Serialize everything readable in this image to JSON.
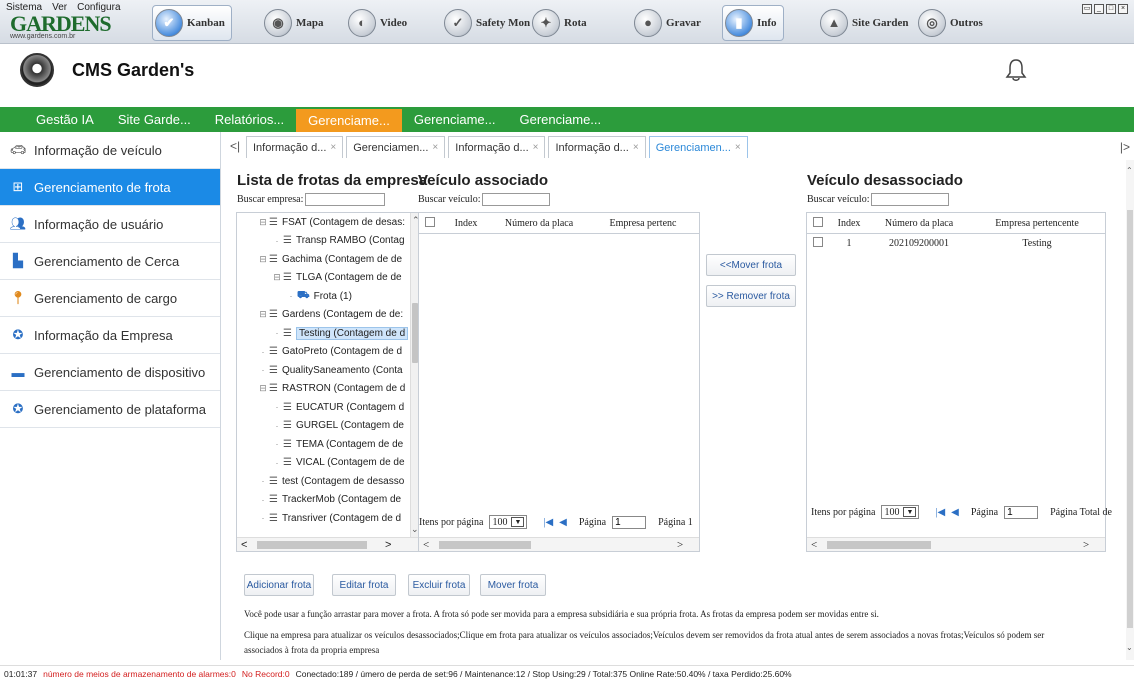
{
  "top_menu": [
    "Sistema",
    "Ver",
    "Configura"
  ],
  "logo": {
    "text": "GARDENS",
    "url": "www.gardens.com.br"
  },
  "toolbar": [
    {
      "label": "Kanban",
      "icon": "check-circle-icon",
      "active": true
    },
    {
      "label": "Mapa",
      "icon": "map-icon",
      "active": false
    },
    {
      "label": "Video",
      "icon": "video-icon",
      "active": false
    },
    {
      "label": "Safety Mon",
      "icon": "shield-icon",
      "active": false
    },
    {
      "label": "Rota",
      "icon": "route-icon",
      "active": false
    },
    {
      "label": "Gravar",
      "icon": "record-icon",
      "active": false
    },
    {
      "label": "Info",
      "icon": "info-chart-icon",
      "active": true
    },
    {
      "label": "Site Garden",
      "icon": "site-icon",
      "active": false
    },
    {
      "label": "Outros",
      "icon": "others-icon",
      "active": false
    }
  ],
  "header": {
    "title": "CMS Garden's"
  },
  "green_nav": [
    "Gestão IA",
    "Site Garde...",
    "Relatórios...",
    "Gerenciame...",
    "Gerenciame...",
    "Gerenciame..."
  ],
  "green_nav_active": 3,
  "sidebar": [
    {
      "label": "Informação de veículo",
      "icon": "car-icon"
    },
    {
      "label": "Gerenciamento de frota",
      "icon": "fleet-icon"
    },
    {
      "label": "Informação de usuário",
      "icon": "users-icon"
    },
    {
      "label": "Gerenciamento de Cerca",
      "icon": "fence-icon"
    },
    {
      "label": "Gerenciamento de cargo",
      "icon": "pin-icon"
    },
    {
      "label": "Informação da Empresa",
      "icon": "company-icon"
    },
    {
      "label": "Gerenciamento de dispositivo",
      "icon": "device-icon"
    },
    {
      "label": "Gerenciamento de plataforma",
      "icon": "platform-icon"
    }
  ],
  "sidebar_active": 1,
  "tabs": [
    "Informação d...",
    "Gerenciamen...",
    "Informação d...",
    "Informação d...",
    "Gerenciamen..."
  ],
  "tabs_active": 4,
  "left_panel": {
    "title": "Lista de frotas da empresa",
    "search_label": "Buscar empresa:",
    "tree": [
      {
        "label": "FSAT  (Contagem de desas:",
        "level": 1,
        "type": "group"
      },
      {
        "label": "Transp RAMBO  (Contag",
        "level": 2,
        "type": "leaf"
      },
      {
        "label": "Gachima  (Contagem de de",
        "level": 1,
        "type": "group"
      },
      {
        "label": "TLGA  (Contagem de de",
        "level": 2,
        "type": "group"
      },
      {
        "label": "Frota  (1)",
        "level": 3,
        "type": "fleet"
      },
      {
        "label": "Gardens  (Contagem de de:",
        "level": 1,
        "type": "group"
      },
      {
        "label": "Testing  (Contagem de d",
        "level": 2,
        "type": "leaf",
        "selected": true
      },
      {
        "label": "GatoPreto  (Contagem de d",
        "level": 1,
        "type": "leaf"
      },
      {
        "label": "QualitySaneamento  (Conta",
        "level": 1,
        "type": "leaf"
      },
      {
        "label": "RASTRON  (Contagem de d",
        "level": 1,
        "type": "group"
      },
      {
        "label": "EUCATUR  (Contagem d",
        "level": 2,
        "type": "leaf"
      },
      {
        "label": "GURGEL  (Contagem de",
        "level": 2,
        "type": "leaf"
      },
      {
        "label": "TEMA  (Contagem de de",
        "level": 2,
        "type": "leaf"
      },
      {
        "label": "VICAL  (Contagem de de",
        "level": 2,
        "type": "leaf"
      },
      {
        "label": "test  (Contagem de desasso",
        "level": 1,
        "type": "leaf"
      },
      {
        "label": "TrackerMob  (Contagem de",
        "level": 1,
        "type": "leaf"
      },
      {
        "label": "Transriver  (Contagem de d",
        "level": 1,
        "type": "leaf"
      }
    ]
  },
  "assoc_panel": {
    "title": "Veículo associado",
    "search_label": "Buscar veículo:",
    "columns": [
      "Index",
      "Número da placa",
      "Empresa pertenc"
    ],
    "rows": [],
    "pager": {
      "items_label": "Itens por página",
      "items_value": "100",
      "page_label": "Página",
      "page_value": "1",
      "page_of": "Página 1"
    }
  },
  "move_buttons": {
    "move": "<<Mover frota",
    "remove": ">> Remover frota"
  },
  "unassoc_panel": {
    "title": "Veículo desassociado",
    "search_label": "Buscar veículo:",
    "columns": [
      "Index",
      "Número da placa",
      "Empresa pertencente"
    ],
    "rows": [
      {
        "index": "1",
        "plate": "202109200001",
        "company": "Testing"
      }
    ],
    "pager": {
      "items_label": "Itens por página",
      "items_value": "100",
      "page_label": "Página",
      "page_value": "1",
      "page_of": "Página  Total de"
    }
  },
  "actions": [
    "Adicionar frota",
    "Editar frota",
    "Excluir frota",
    "Mover frota"
  ],
  "notes": [
    "Você pode usar a função arrastar para mover a frota. A frota só pode ser movida para a empresa subsidiária e sua própria frota. As frotas da empresa podem ser movidas entre si.",
    "Clique na empresa para atualizar os veículos desassociados;Clique em frota para atualizar os veículos associados;Veículos devem ser removidos da frota atual antes de serem associados a novas frotas;Veículos só podem ser",
    "associados à frota da propria empresa"
  ],
  "status": {
    "time": "01:01:37",
    "alarm_storage": "número de meios de armazenamento de alarmes:0",
    "no_record": "No Record:0",
    "stats": "Conectado:189 / úmero de perda de set:96 / Maintenance:12 / Stop Using:29 / Total:375   Online Rate:50.40% / taxa Perdido:25.60%"
  },
  "colors": {
    "green_nav": "#2c9c3c",
    "active_orange": "#f39a1e",
    "active_blue": "#1b8ae6",
    "status_red": "#d32020"
  }
}
